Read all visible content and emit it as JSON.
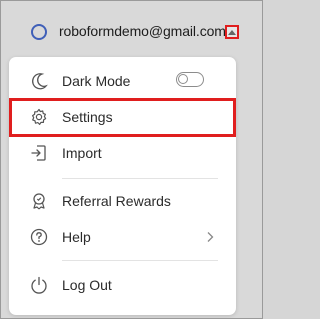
{
  "header": {
    "email": "roboformdemo@gmail.com",
    "icons": {
      "avatar": "user-circle-icon",
      "caret": "caret-up-icon"
    }
  },
  "menu": {
    "items": [
      {
        "label": "Dark Mode",
        "icon": "moon-icon",
        "toggle": "off"
      },
      {
        "label": "Settings",
        "icon": "gear-icon",
        "highlighted": true
      },
      {
        "label": "Import",
        "icon": "import-icon"
      },
      {
        "label": "Referral Rewards",
        "icon": "badge-icon"
      },
      {
        "label": "Help",
        "icon": "question-circle-icon",
        "submenu": true
      },
      {
        "label": "Log Out",
        "icon": "power-icon"
      }
    ]
  },
  "colors": {
    "highlight": "#e01e1e",
    "accent": "#3f5fb8"
  }
}
